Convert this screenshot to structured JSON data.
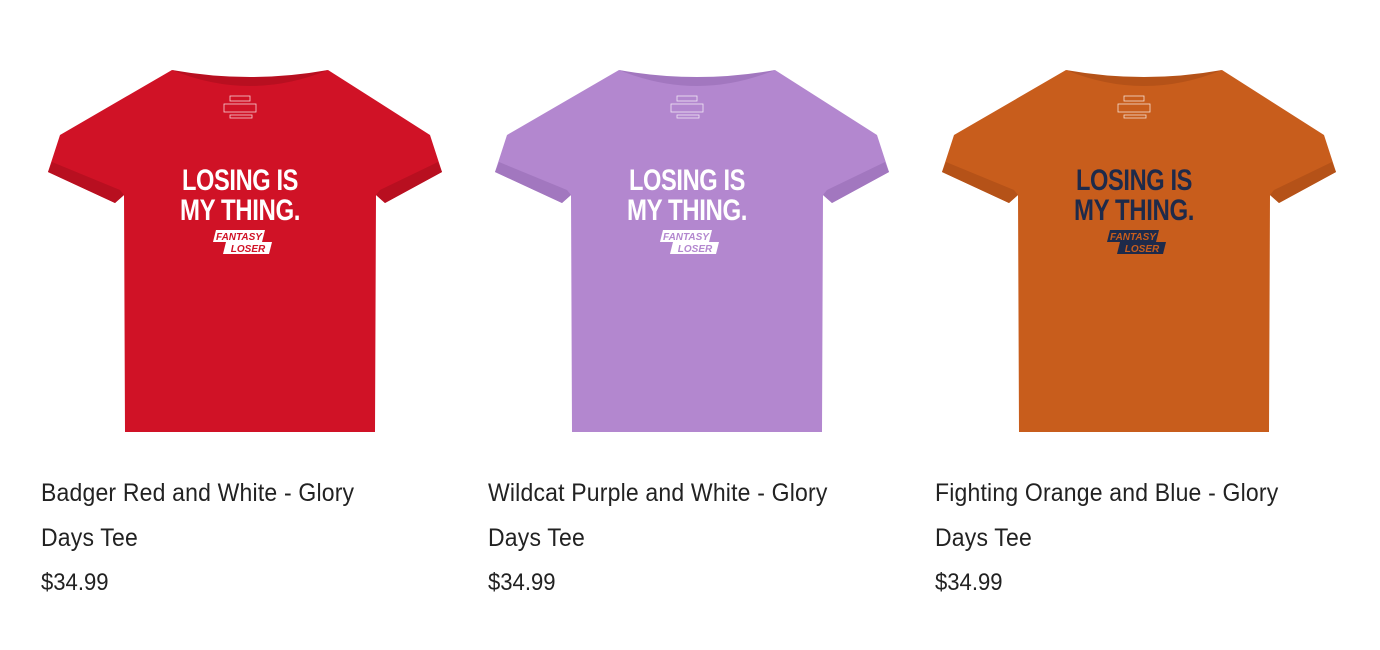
{
  "products": [
    {
      "title": "Badger Red and White - Glory Days Tee",
      "price": "$34.99",
      "shirt_color": "#d01226",
      "shirt_shade": "#b80f20",
      "print_color": "#ffffff",
      "logo_fg": "#d01226",
      "print_line1": "LOSING IS",
      "print_line2": "MY THING.",
      "logo_line1": "FANTASY",
      "logo_line2": "LOSER"
    },
    {
      "title": "Wildcat Purple and White - Glory Days Tee",
      "price": "$34.99",
      "shirt_color": "#b387cf",
      "shirt_shade": "#a277bf",
      "print_color": "#ffffff",
      "logo_fg": "#b387cf",
      "print_line1": "LOSING IS",
      "print_line2": "MY THING.",
      "logo_line1": "FANTASY",
      "logo_line2": "LOSER"
    },
    {
      "title": "Fighting Orange and Blue - Glory Days Tee",
      "price": "$34.99",
      "shirt_color": "#c85d1c",
      "shirt_shade": "#b55218",
      "print_color": "#1e2a4a",
      "logo_fg": "#c85d1c",
      "print_line1": "LOSING IS",
      "print_line2": "MY THING.",
      "logo_line1": "FANTASY",
      "logo_line2": "LOSER"
    }
  ]
}
